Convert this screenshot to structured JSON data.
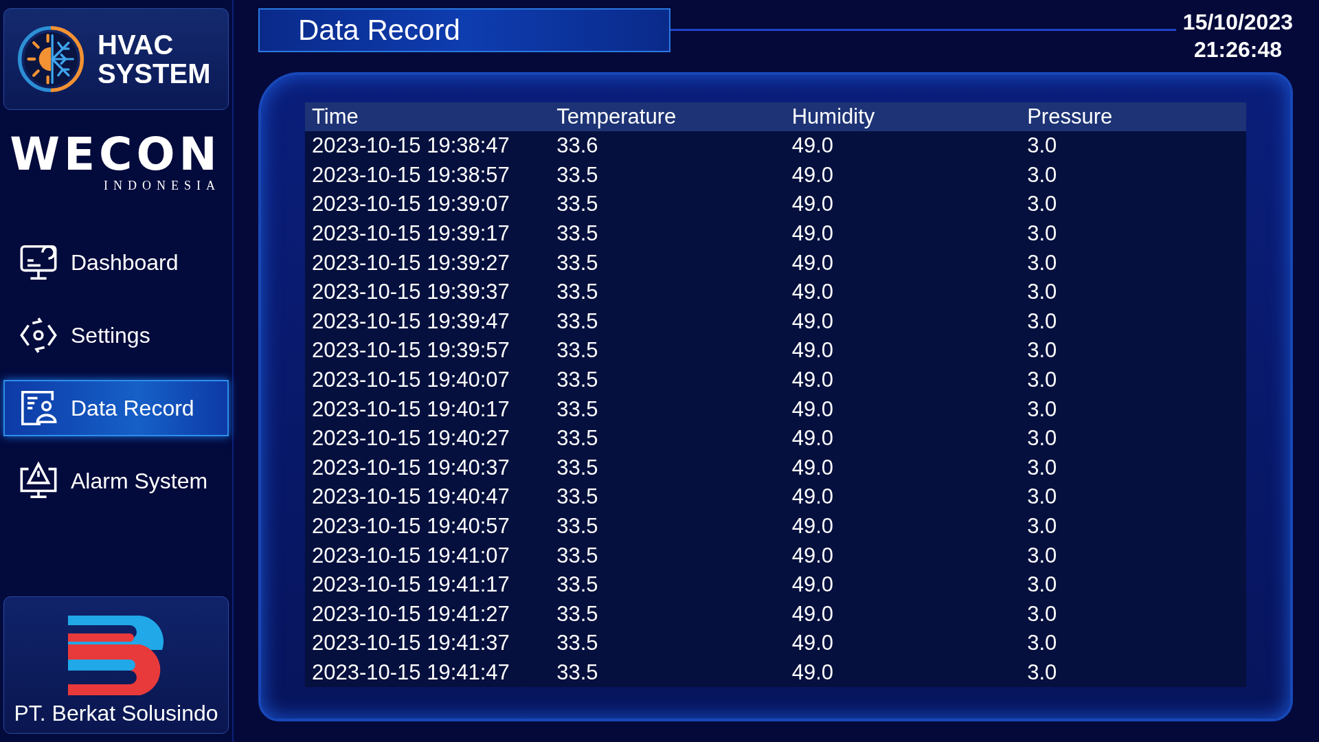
{
  "brand": {
    "title_line1": "HVAC",
    "title_line2": "SYSTEM"
  },
  "partner_logo": {
    "name": "WECON",
    "subtitle": "INDONESIA"
  },
  "nav": [
    {
      "label": "Dashboard",
      "kind": "monitor",
      "selected": false
    },
    {
      "label": "Settings",
      "kind": "settings",
      "selected": false
    },
    {
      "label": "Data Record",
      "kind": "record",
      "selected": true
    },
    {
      "label": "Alarm System",
      "kind": "alarm",
      "selected": false
    }
  ],
  "company": {
    "name": "PT. Berkat Solusindo"
  },
  "page_title": "Data Record",
  "datetime": {
    "date": "15/10/2023",
    "time": "21:26:48"
  },
  "table": {
    "columns": [
      "Time",
      "Temperature",
      "Humidity",
      "Pressure"
    ],
    "rows": [
      [
        "2023-10-15 19:38:47",
        "33.6",
        "49.0",
        "3.0"
      ],
      [
        "2023-10-15 19:38:57",
        "33.5",
        "49.0",
        "3.0"
      ],
      [
        "2023-10-15 19:39:07",
        "33.5",
        "49.0",
        "3.0"
      ],
      [
        "2023-10-15 19:39:17",
        "33.5",
        "49.0",
        "3.0"
      ],
      [
        "2023-10-15 19:39:27",
        "33.5",
        "49.0",
        "3.0"
      ],
      [
        "2023-10-15 19:39:37",
        "33.5",
        "49.0",
        "3.0"
      ],
      [
        "2023-10-15 19:39:47",
        "33.5",
        "49.0",
        "3.0"
      ],
      [
        "2023-10-15 19:39:57",
        "33.5",
        "49.0",
        "3.0"
      ],
      [
        "2023-10-15 19:40:07",
        "33.5",
        "49.0",
        "3.0"
      ],
      [
        "2023-10-15 19:40:17",
        "33.5",
        "49.0",
        "3.0"
      ],
      [
        "2023-10-15 19:40:27",
        "33.5",
        "49.0",
        "3.0"
      ],
      [
        "2023-10-15 19:40:37",
        "33.5",
        "49.0",
        "3.0"
      ],
      [
        "2023-10-15 19:40:47",
        "33.5",
        "49.0",
        "3.0"
      ],
      [
        "2023-10-15 19:40:57",
        "33.5",
        "49.0",
        "3.0"
      ],
      [
        "2023-10-15 19:41:07",
        "33.5",
        "49.0",
        "3.0"
      ],
      [
        "2023-10-15 19:41:17",
        "33.5",
        "49.0",
        "3.0"
      ],
      [
        "2023-10-15 19:41:27",
        "33.5",
        "49.0",
        "3.0"
      ],
      [
        "2023-10-15 19:41:37",
        "33.5",
        "49.0",
        "3.0"
      ],
      [
        "2023-10-15 19:41:47",
        "33.5",
        "49.0",
        "3.0"
      ]
    ]
  }
}
